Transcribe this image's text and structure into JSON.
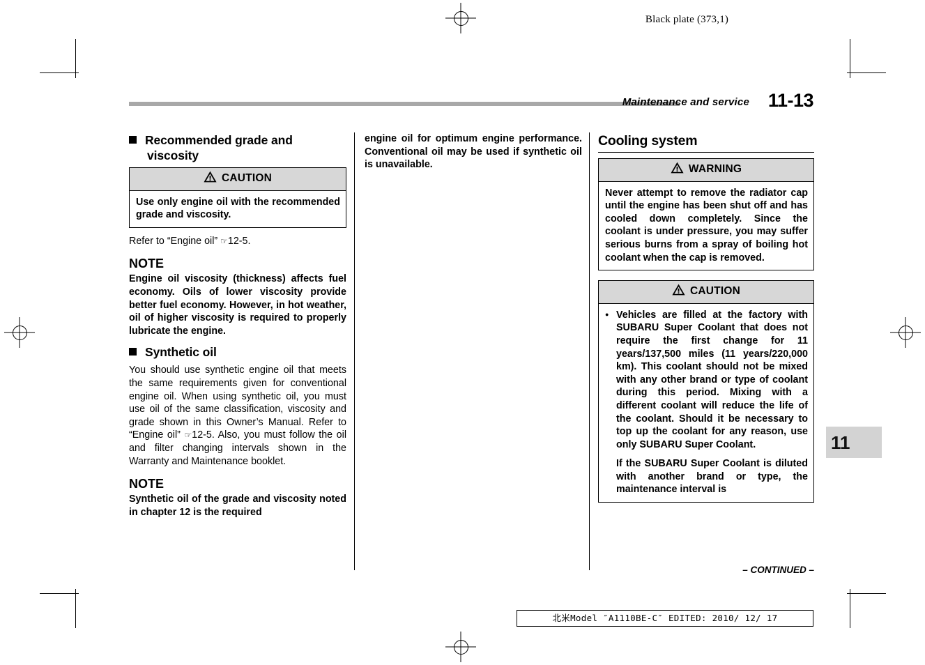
{
  "page": {
    "black_plate": "Black plate (373,1)",
    "chapter_title": "Maintenance and service",
    "chapter_number": "11-13",
    "side_tab": "11",
    "continued": "– CONTINUED –",
    "footer": "北米Model ″A1110BE-C″ EDITED: 2010/ 12/ 17"
  },
  "column1": {
    "heading1": "Recommended grade and viscosity",
    "caution": {
      "label": "CAUTION",
      "body": "Use only engine oil with the recommended grade and viscosity."
    },
    "refer_text": "Refer to “Engine oil” ",
    "refer_mark": "☞",
    "refer_page": "12-5.",
    "note1_label": "NOTE",
    "note1_body": "Engine oil viscosity (thickness) affects fuel economy. Oils of lower viscosity provide better fuel economy. However, in hot weather, oil of higher viscosity is required to properly lubricate the engine.",
    "heading2": "Synthetic oil",
    "para1_a": "You should use synthetic engine oil that meets the same requirements given for conventional engine oil. When using synthetic oil, you must use oil of the same classification, viscosity and grade shown in this Owner’s Manual. Refer to “Engine oil” ",
    "para1_b": "12-5. Also, you must follow the oil and filter changing intervals shown in the Warranty and Maintenance booklet.",
    "note2_label": "NOTE",
    "note2_body": "Synthetic oil of the grade and viscosity noted in chapter 12 is the required"
  },
  "column2": {
    "para_continued": "engine oil for optimum engine performance. Conventional oil may be used if synthetic oil is unavailable."
  },
  "column3": {
    "heading": "Cooling system",
    "warning": {
      "label": "WARNING",
      "body": "Never attempt to remove the radiator cap until the engine has been shut off and has cooled down completely. Since the coolant is under pressure, you may suffer serious burns from a spray of boiling hot coolant when the cap is removed."
    },
    "caution": {
      "label": "CAUTION",
      "bullet1": "Vehicles are filled at the factory with SUBARU Super Coolant that does not require the first change for 11 years/137,500 miles (11 years/220,000 km). This coolant should not be mixed with any other brand or type of coolant during this period. Mixing with a different coolant will reduce the life of the coolant. Should it be necessary to top up the coolant for any reason, use only SUBARU Super Coolant.",
      "para2": "If the SUBARU Super Coolant is diluted with another brand or type, the maintenance interval is"
    }
  }
}
